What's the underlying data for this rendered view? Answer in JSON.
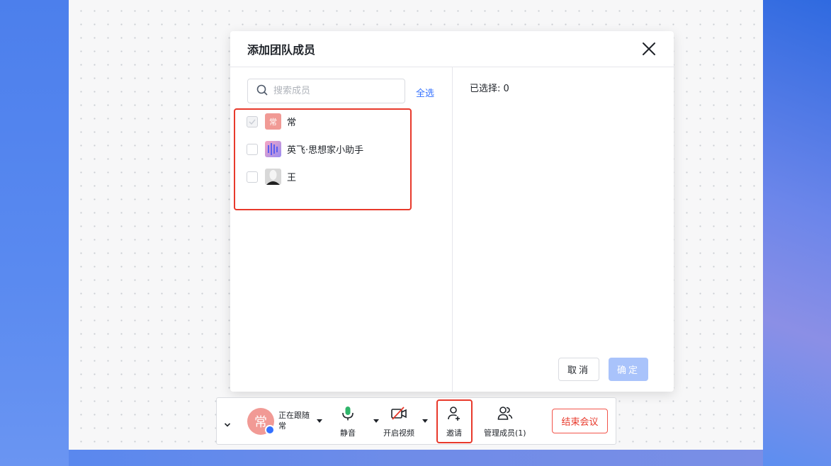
{
  "dialog": {
    "title": "添加团队成员",
    "search": {
      "placeholder": "搜索成员",
      "value": ""
    },
    "select_all": "全选",
    "members": [
      {
        "name": "常",
        "avatar_text": "常",
        "checked": false,
        "disabled": true
      },
      {
        "name": "英飞·思想家小助手",
        "avatar_text": "",
        "checked": false,
        "disabled": false
      },
      {
        "name": "王",
        "avatar_text": "",
        "checked": false,
        "disabled": false
      }
    ],
    "selected_label": "已选择:  0",
    "cancel": "取消",
    "confirm": "确定"
  },
  "toolbar": {
    "avatar_text": "常",
    "following_label": "正在跟随",
    "following_name": "常",
    "mute": "静音",
    "video": "开启视频",
    "invite": "邀请",
    "manage_members": "管理成员(1)",
    "end_meeting": "结束会议"
  },
  "colors": {
    "accent": "#3370ff",
    "danger": "#e8392b",
    "confirm_disabled": "#a9c3fb",
    "avatar_pink": "#f19a95"
  }
}
